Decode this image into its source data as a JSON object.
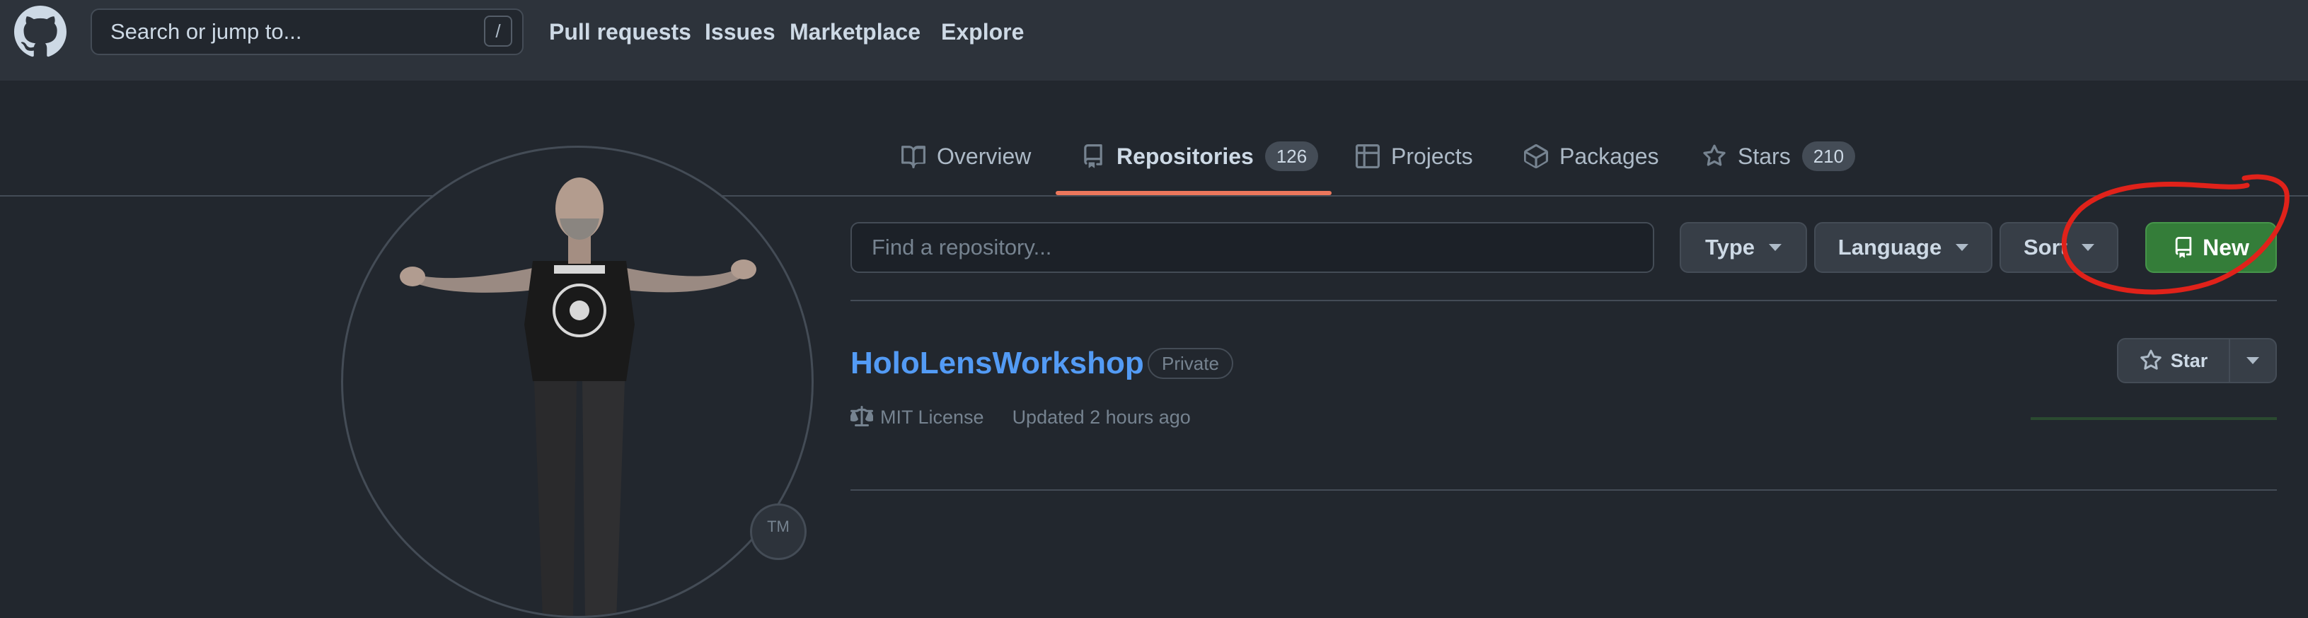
{
  "header": {
    "search_placeholder": "Search or jump to...",
    "search_shortcut": "/",
    "nav": [
      "Pull requests",
      "Issues",
      "Marketplace",
      "Explore"
    ]
  },
  "tabs": [
    {
      "label": "Overview",
      "icon": "book-icon"
    },
    {
      "label": "Repositories",
      "icon": "repo-icon",
      "count": "126",
      "selected": true
    },
    {
      "label": "Projects",
      "icon": "table-icon"
    },
    {
      "label": "Packages",
      "icon": "package-icon"
    },
    {
      "label": "Stars",
      "icon": "star-icon",
      "count": "210"
    }
  ],
  "profile": {
    "badge": "TM"
  },
  "filters": {
    "find_placeholder": "Find a repository...",
    "type_label": "Type",
    "language_label": "Language",
    "sort_label": "Sort",
    "new_label": "New"
  },
  "repo": {
    "name": "HoloLensWorkshop",
    "visibility": "Private",
    "license": "MIT License",
    "updated": "Updated 2 hours ago",
    "star_label": "Star"
  },
  "colors": {
    "accent_underline": "#ec775c",
    "new_button": "#347d39",
    "link": "#539bf5",
    "annotation": "#e0221a"
  }
}
